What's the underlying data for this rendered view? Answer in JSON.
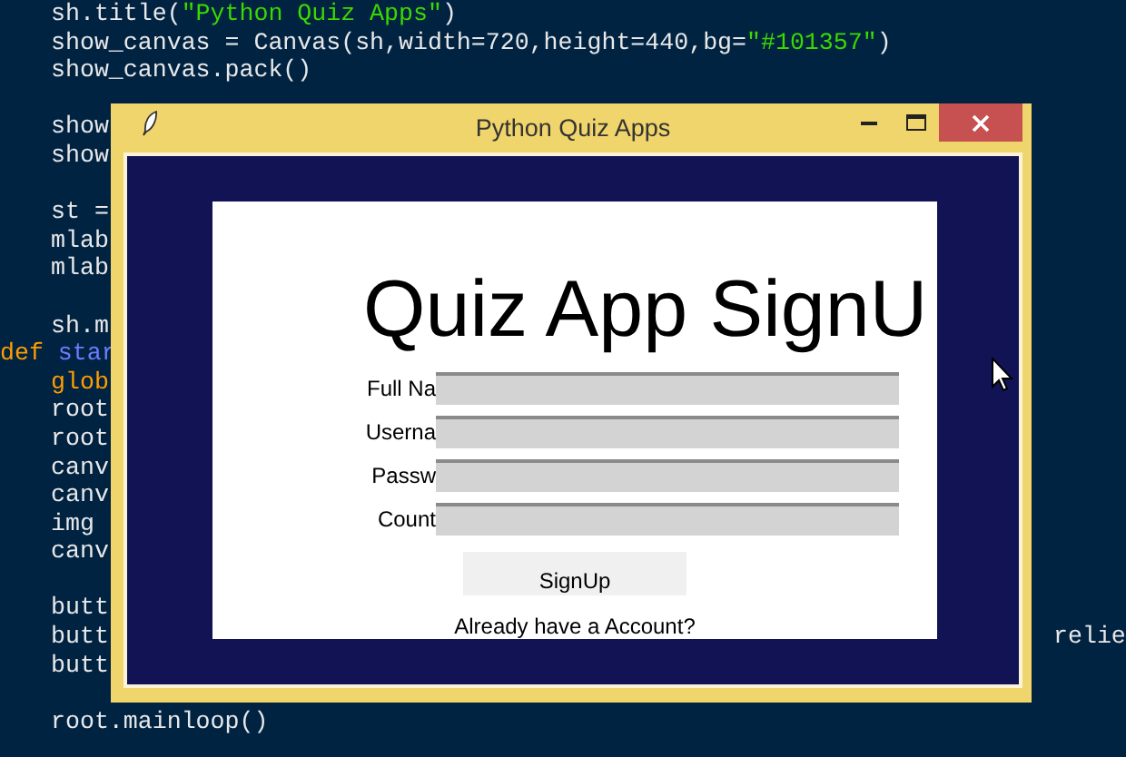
{
  "editor": {
    "lines": [
      {
        "segments": [
          {
            "text": "sh.title(",
            "kind": "plain"
          },
          {
            "text": "\"Python Quiz Apps\"",
            "kind": "string"
          },
          {
            "text": ")",
            "kind": "plain"
          }
        ]
      },
      {
        "segments": [
          {
            "text": "show_canvas = Canvas(sh,width=720,height=440,bg=",
            "kind": "plain"
          },
          {
            "text": "\"#101357\"",
            "kind": "string"
          },
          {
            "text": ")",
            "kind": "plain"
          }
        ]
      },
      {
        "segments": [
          {
            "text": "show_canvas.pack()",
            "kind": "plain"
          }
        ]
      },
      {
        "blank_before": true,
        "segments": [
          {
            "text": "show",
            "kind": "plain"
          }
        ]
      },
      {
        "segments": [
          {
            "text": "show",
            "kind": "plain"
          }
        ]
      },
      {
        "blank_before": true,
        "segments": [
          {
            "text": "st =",
            "kind": "plain"
          }
        ]
      },
      {
        "segments": [
          {
            "text": "mlab",
            "kind": "plain"
          }
        ]
      },
      {
        "segments": [
          {
            "text": "mlab",
            "kind": "plain"
          }
        ]
      },
      {
        "blank_before": true,
        "segments": [
          {
            "text": "sh.m",
            "kind": "plain"
          }
        ]
      },
      {
        "outdent": true,
        "segments": [
          {
            "text": "def ",
            "kind": "keyword"
          },
          {
            "text": "star",
            "kind": "function"
          }
        ]
      },
      {
        "segments": [
          {
            "text": "glob",
            "kind": "keyword"
          }
        ]
      },
      {
        "segments": [
          {
            "text": "root",
            "kind": "plain"
          }
        ]
      },
      {
        "segments": [
          {
            "text": "root",
            "kind": "plain"
          }
        ]
      },
      {
        "segments": [
          {
            "text": "canv",
            "kind": "plain"
          }
        ]
      },
      {
        "segments": [
          {
            "text": "canv",
            "kind": "plain"
          }
        ]
      },
      {
        "segments": [
          {
            "text": "img",
            "kind": "plain"
          }
        ]
      },
      {
        "segments": [
          {
            "text": "canv",
            "kind": "plain"
          }
        ]
      },
      {
        "blank_before": true,
        "segments": [
          {
            "text": "butt",
            "kind": "plain"
          }
        ]
      },
      {
        "segments": [
          {
            "text": "butt",
            "kind": "plain"
          }
        ],
        "right_text": "relie"
      },
      {
        "segments": [
          {
            "text": "butt",
            "kind": "plain"
          }
        ]
      },
      {
        "blank_before": true,
        "segments": [
          {
            "text": "root.mainloop()",
            "kind": "plain"
          }
        ]
      }
    ]
  },
  "window": {
    "title": "Python Quiz Apps",
    "form": {
      "heading": "Quiz App SignU",
      "fields": [
        {
          "label": "Full Na"
        },
        {
          "label": "Userna"
        },
        {
          "label": "Passw"
        },
        {
          "label": "Count"
        }
      ],
      "button": "SignUp",
      "link": "Already have a Account?"
    }
  }
}
